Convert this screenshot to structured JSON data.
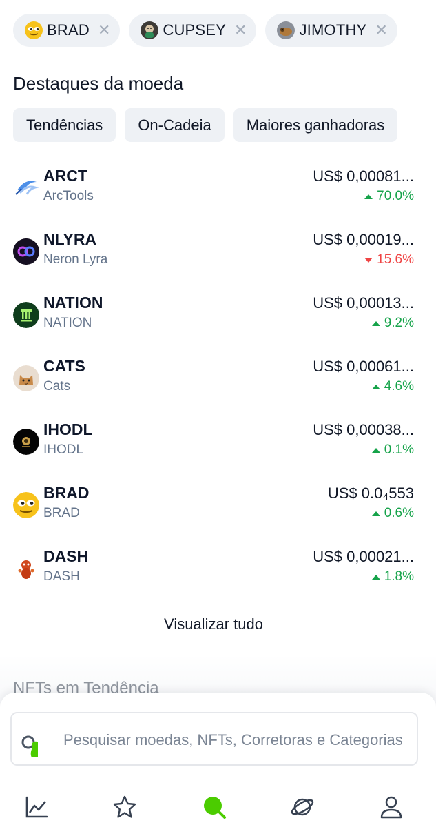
{
  "recent": [
    {
      "label": "BRAD"
    },
    {
      "label": "CUPSEY"
    },
    {
      "label": "JIMOTHY"
    }
  ],
  "highlights": {
    "title": "Destaques da moeda",
    "tabs": [
      "Tendências",
      "On-Cadeia",
      "Maiores ganhadoras"
    ]
  },
  "coins": [
    {
      "symbol": "ARCT",
      "name": "ArcTools",
      "price": "US$ 0,00081...",
      "change": "70.0%",
      "direction": "up",
      "icon": "arctools-logo-icon"
    },
    {
      "symbol": "NLYRA",
      "name": "Neron Lyra",
      "price": "US$ 0,00019...",
      "change": "15.6%",
      "direction": "down",
      "icon": "neron-lyra-logo-icon"
    },
    {
      "symbol": "NATION",
      "name": "NATION",
      "price": "US$ 0,00013...",
      "change": "9.2%",
      "direction": "up",
      "icon": "nation-logo-icon"
    },
    {
      "symbol": "CATS",
      "name": "Cats",
      "price": "US$ 0,00061...",
      "change": "4.6%",
      "direction": "up",
      "icon": "cats-logo-icon"
    },
    {
      "symbol": "IHODL",
      "name": "IHODL",
      "price": "US$ 0,00038...",
      "change": "0.1%",
      "direction": "up",
      "icon": "ihodl-logo-icon"
    },
    {
      "symbol": "BRAD",
      "name": "BRAD",
      "price": "US$ 0.0₄553",
      "change": "0.6%",
      "direction": "up",
      "icon": "brad-logo-icon"
    },
    {
      "symbol": "DASH",
      "name": "DASH",
      "price": "US$ 0,00021...",
      "change": "1.8%",
      "direction": "up",
      "icon": "dash-logo-icon"
    }
  ],
  "view_all": "Visualizar tudo",
  "nft_section_title": "NFTs em Tendência",
  "search": {
    "placeholder": "Pesquisar moedas, NFTs, Corretoras e Categorias"
  },
  "colors": {
    "up": "#16a34a",
    "down": "#ef4444",
    "accent": "#4bcc00"
  },
  "nav": [
    "chart-icon",
    "star-icon",
    "search-icon",
    "planet-icon",
    "profile-icon"
  ]
}
